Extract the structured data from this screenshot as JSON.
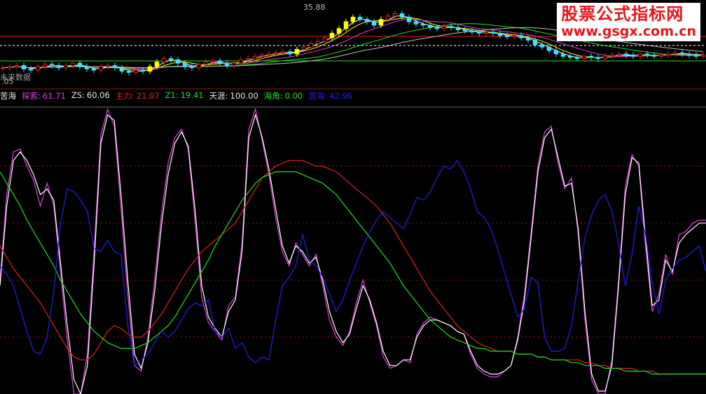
{
  "watermark": {
    "title": "股票公式指标网",
    "url": "www.gsgx.com.cn"
  },
  "upper_panel": {
    "peak_price_label": "35.88",
    "low_price_label": ".05",
    "note_label": "未来数据"
  },
  "indicator": {
    "name": "苦海",
    "items": [
      {
        "label": "探索:",
        "value": "61.71",
        "color": "#e040e0"
      },
      {
        "label": "ZS:",
        "value": "60.06",
        "color": "#e8e8e8"
      },
      {
        "label": "主力:",
        "value": "21.07",
        "color": "#e02020"
      },
      {
        "label": "Z1:",
        "value": "19.41",
        "color": "#20e020"
      },
      {
        "label": "天涯:",
        "value": "100.00",
        "color": "#e8e8e8"
      },
      {
        "label": "海角:",
        "value": "0.00",
        "color": "#20e020"
      },
      {
        "label": "苦海:",
        "value": "42.96",
        "color": "#2020f0"
      }
    ]
  },
  "chart_data": [
    {
      "type": "candlestick",
      "title": "",
      "annotations": [
        "35.88",
        "未来数据",
        ".05"
      ],
      "up_color": "#e02020",
      "down_color": "#40e0ff",
      "highlight_color": "#ffff00",
      "candles_close": [
        30.8,
        30.9,
        31.0,
        30.7,
        30.6,
        30.9,
        31.1,
        31.0,
        30.8,
        31.0,
        31.2,
        30.9,
        30.7,
        30.6,
        30.9,
        31.0,
        30.8,
        30.5,
        30.4,
        30.6,
        30.5,
        30.9,
        31.3,
        31.6,
        31.5,
        31.2,
        30.9,
        30.8,
        31.1,
        31.3,
        31.4,
        31.2,
        31.0,
        31.2,
        31.5,
        31.6,
        31.8,
        31.9,
        32.0,
        32.1,
        32.2,
        32.0,
        32.4,
        32.6,
        32.9,
        33.1,
        33.4,
        33.8,
        34.2,
        34.8,
        35.2,
        35.0,
        34.8,
        34.5,
        35.0,
        35.3,
        35.5,
        35.2,
        34.8,
        34.6,
        34.5,
        34.3,
        34.2,
        34.4,
        34.3,
        34.1,
        34.0,
        33.9,
        33.8,
        33.9,
        33.8,
        33.6,
        33.5,
        33.6,
        33.4,
        33.2,
        32.8,
        32.6,
        32.3,
        32.0,
        31.8,
        31.7,
        31.6,
        31.8,
        31.7,
        31.6,
        31.8,
        31.9,
        32.0,
        31.9,
        31.8,
        32.0,
        31.9,
        31.8,
        31.9,
        32.0,
        32.1,
        32.0,
        31.9,
        31.8,
        31.9
      ],
      "ma_series": [
        {
          "color": "#ffffff"
        },
        {
          "color": "#ffff00"
        },
        {
          "color": "#e040e0"
        },
        {
          "color": "#20e020"
        },
        {
          "color": "#c0c0c0"
        }
      ],
      "reference_lines": [
        {
          "color": "#e02020",
          "style": "solid",
          "level": "upper"
        },
        {
          "color": "#ffffff",
          "style": "dashed",
          "level": "middle"
        },
        {
          "color": "#20e020",
          "style": "solid",
          "level": "lower"
        }
      ]
    },
    {
      "type": "line",
      "title": "苦海",
      "ylim": [
        0,
        100
      ],
      "grid": true,
      "grid_levels": [
        20,
        40,
        60,
        80
      ],
      "grid_color": "#8b1a1a",
      "series": [
        {
          "name": "探索",
          "color": "#e040e0",
          "values": [
            40,
            70,
            85,
            86,
            80,
            75,
            66,
            74,
            66,
            43,
            19,
            0,
            0,
            14,
            51,
            91,
            100,
            94,
            65,
            35,
            10,
            8,
            20,
            40,
            63,
            81,
            90,
            93,
            86,
            61,
            34,
            25,
            22,
            19,
            31,
            34,
            53,
            93,
            100,
            89,
            77,
            62,
            50,
            45,
            53,
            49,
            45,
            49,
            38,
            26,
            20,
            17,
            22,
            32,
            40,
            32,
            24,
            13,
            9,
            10,
            12,
            11,
            21,
            25,
            27,
            26,
            25,
            24,
            22,
            21,
            14,
            9,
            7,
            6,
            6,
            8,
            10,
            20,
            35,
            57,
            80,
            92,
            94,
            81,
            72,
            76,
            56,
            26,
            5,
            0,
            0,
            12,
            40,
            73,
            84,
            80,
            52,
            29,
            35,
            49,
            42,
            56,
            57,
            60,
            61,
            61
          ]
        },
        {
          "name": "ZS",
          "color": "#ffffff",
          "values": [
            38,
            66,
            82,
            85,
            82,
            77,
            70,
            72,
            68,
            46,
            24,
            5,
            0,
            10,
            46,
            88,
            98,
            96,
            70,
            40,
            14,
            9,
            18,
            36,
            59,
            77,
            88,
            92,
            87,
            65,
            38,
            27,
            23,
            20,
            29,
            33,
            50,
            90,
            98,
            90,
            79,
            65,
            52,
            46,
            52,
            50,
            46,
            48,
            40,
            29,
            22,
            18,
            21,
            30,
            38,
            33,
            25,
            15,
            10,
            10,
            12,
            12,
            20,
            24,
            26,
            26,
            25,
            24,
            22,
            21,
            15,
            10,
            8,
            7,
            7,
            8,
            10,
            19,
            33,
            55,
            78,
            90,
            93,
            83,
            73,
            74,
            58,
            29,
            7,
            1,
            1,
            10,
            38,
            70,
            83,
            81,
            55,
            31,
            33,
            47,
            43,
            53,
            56,
            58,
            60,
            60
          ]
        },
        {
          "name": "主力",
          "color": "#e02020",
          "values": [
            52,
            48,
            44,
            41,
            38,
            35,
            32,
            28,
            24,
            20,
            16,
            13,
            12,
            12,
            14,
            18,
            22,
            24,
            23,
            21,
            20,
            20,
            22,
            25,
            28,
            32,
            36,
            40,
            44,
            47,
            50,
            52,
            54,
            56,
            58,
            60,
            64,
            68,
            72,
            76,
            78,
            80,
            81,
            82,
            82,
            82,
            81,
            80,
            80,
            79,
            78,
            76,
            74,
            72,
            70,
            68,
            66,
            63,
            60,
            56,
            52,
            48,
            44,
            40,
            36,
            33,
            30,
            27,
            24,
            22,
            20,
            18,
            17,
            16,
            15,
            15,
            15,
            14,
            14,
            14,
            13,
            13,
            12,
            12,
            12,
            12,
            12,
            11,
            11,
            10,
            10,
            9,
            9,
            9,
            9,
            8,
            8,
            8,
            7,
            7,
            7,
            7,
            7,
            7,
            7,
            7
          ]
        },
        {
          "name": "Z1",
          "color": "#20e020",
          "values": [
            78,
            74,
            70,
            66,
            61,
            57,
            53,
            49,
            45,
            40,
            36,
            32,
            28,
            25,
            22,
            20,
            18,
            17,
            16,
            16,
            16,
            17,
            18,
            20,
            22,
            24,
            27,
            31,
            35,
            39,
            43,
            47,
            52,
            56,
            60,
            64,
            68,
            71,
            74,
            76,
            77,
            78,
            78,
            78,
            78,
            77,
            76,
            75,
            74,
            72,
            70,
            67,
            64,
            61,
            58,
            55,
            52,
            49,
            46,
            42,
            38,
            35,
            32,
            29,
            26,
            24,
            22,
            20,
            19,
            18,
            17,
            16,
            16,
            15,
            15,
            15,
            15,
            14,
            14,
            14,
            13,
            13,
            12,
            12,
            12,
            11,
            11,
            10,
            10,
            10,
            9,
            9,
            9,
            8,
            8,
            8,
            8,
            7,
            7,
            7,
            7,
            7,
            7,
            7,
            7,
            7
          ]
        },
        {
          "name": "苦海",
          "color": "#2020f0",
          "values": [
            45,
            42,
            38,
            30,
            22,
            15,
            14,
            20,
            36,
            60,
            72,
            71,
            68,
            64,
            51,
            50,
            54,
            50,
            49,
            24,
            10,
            12,
            14,
            18,
            22,
            20,
            22,
            26,
            30,
            32,
            31,
            33,
            22,
            20,
            23,
            16,
            18,
            13,
            11,
            13,
            12,
            26,
            38,
            41,
            45,
            56,
            47,
            45,
            41,
            35,
            29,
            33,
            40,
            46,
            52,
            57,
            61,
            64,
            62,
            60,
            58,
            63,
            69,
            68,
            71,
            76,
            80,
            79,
            82,
            78,
            72,
            64,
            62,
            58,
            51,
            43,
            35,
            27,
            30,
            41,
            39,
            20,
            15,
            15,
            16,
            24,
            40,
            55,
            63,
            68,
            70,
            64,
            53,
            38,
            49,
            66,
            56,
            39,
            28,
            40,
            44,
            47,
            48,
            50,
            52,
            43
          ]
        }
      ]
    }
  ]
}
